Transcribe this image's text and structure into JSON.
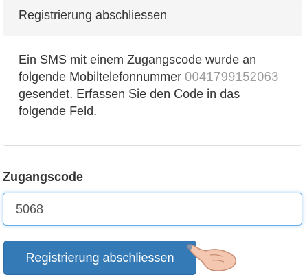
{
  "panel": {
    "title": "Registrierung abschliessen",
    "message_before": "Ein SMS mit einem Zugangscode wurde an folgende Mobiltelefonnummer ",
    "phone_masked": "0041799152063",
    "message_after": " gesendet. Erfassen Sie den Code in das folgende Feld."
  },
  "form": {
    "code_label": "Zugangscode",
    "code_value": "5068"
  },
  "actions": {
    "submit_label": "Registrierung abschliessen"
  },
  "colors": {
    "primary": "#337ab7",
    "focus_border": "#66afe9",
    "panel_header_bg": "#f5f5f5"
  },
  "overlay": {
    "pointer_icon": "pointing-hand-icon"
  }
}
